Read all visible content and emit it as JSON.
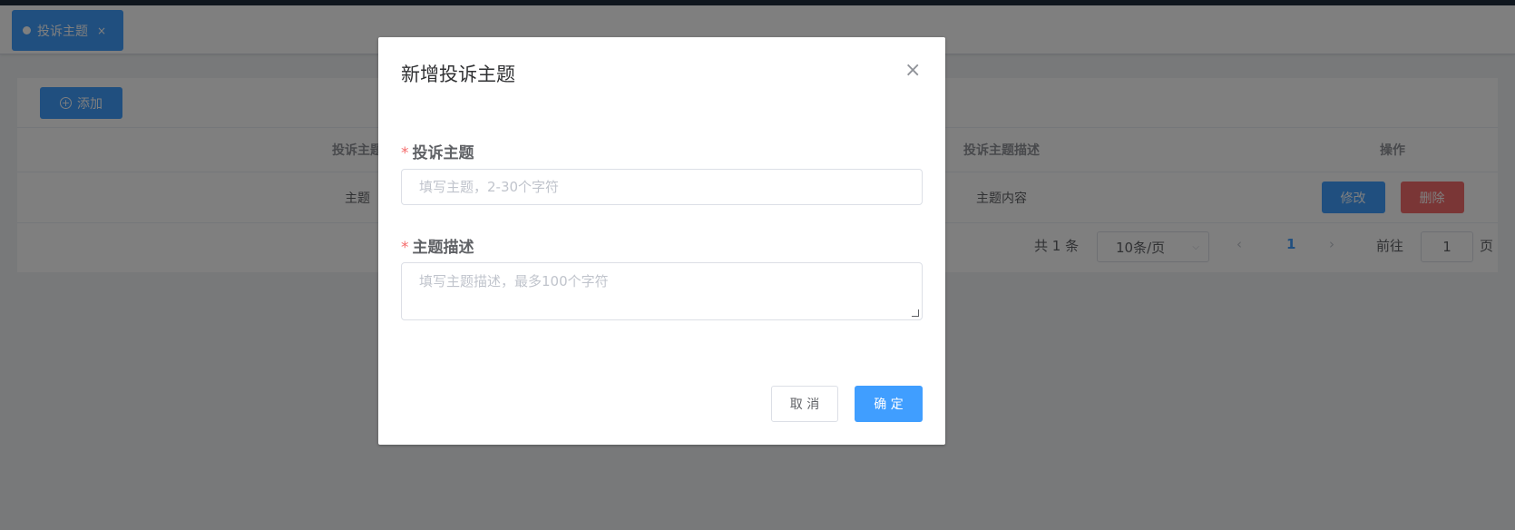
{
  "tabs": [
    {
      "label": "投诉主题",
      "close_glyph": "×",
      "icon": "dot-icon"
    }
  ],
  "toolbar": {
    "add_label": "添加",
    "add_icon": "plus-circle-icon"
  },
  "table": {
    "columns": [
      "投诉主题",
      "投诉主题描述",
      "操作"
    ],
    "rows": [
      {
        "topic": "主题",
        "description": "主题内容",
        "actions": [
          "修改",
          "删除"
        ]
      }
    ]
  },
  "pagination": {
    "total_text": "共 1 条",
    "page_size": "10条/页",
    "current_page": "1",
    "goto_label": "前往",
    "goto_value": "1",
    "page_unit": "页"
  },
  "dialog": {
    "title": "新增投诉主题",
    "close_glyph": "×",
    "fields": [
      {
        "label": "投诉主题",
        "required": "*",
        "placeholder": "填写主题，2-30个字符"
      },
      {
        "label": "主题描述",
        "required": "*",
        "placeholder": "填写主题描述，最多100个字符"
      }
    ],
    "cancel_label": "取 消",
    "confirm_label": "确 定"
  },
  "colors": {
    "primary": "#409eff",
    "danger": "#f56c6c",
    "required": "#f56c6c"
  }
}
